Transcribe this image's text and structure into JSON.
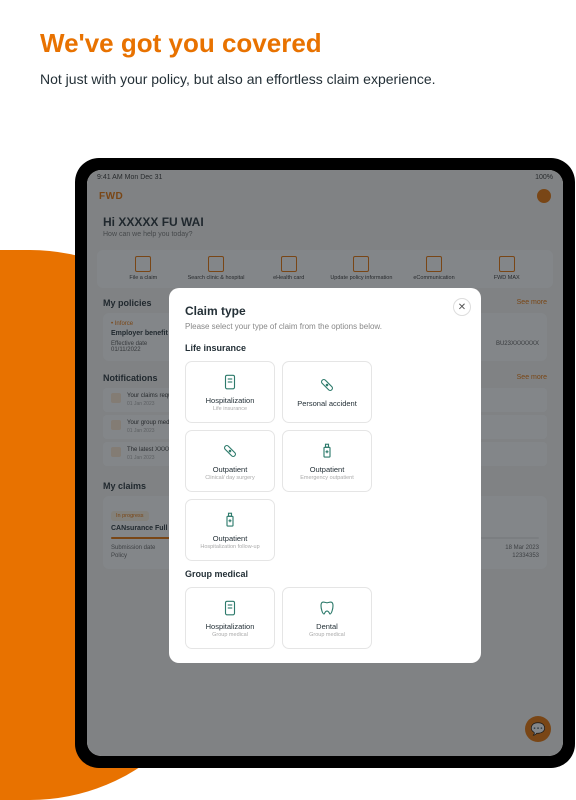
{
  "hero": {
    "title": "We've got you covered",
    "subtitle": "Not just with your policy, but also an effortless claim experience."
  },
  "status": {
    "time": "9:41 AM Mon Dec 31",
    "right": "100%"
  },
  "brand": "FWD",
  "greeting": {
    "hello": "Hi XXXXX FU WAI",
    "sub": "How can we help you today?"
  },
  "quickActions": [
    {
      "label": "File a claim"
    },
    {
      "label": "Search clinic & hospital"
    },
    {
      "label": "eHealth card"
    },
    {
      "label": "Update policy information"
    },
    {
      "label": "eCommunication"
    },
    {
      "label": "FWD MAX"
    }
  ],
  "policies": {
    "heading": "My policies",
    "seeMore": "See more",
    "card": {
      "tag": "• Inforce",
      "name": "Employer benefit\nGroup Medical Insurance",
      "effLabel": "Effective date",
      "effDate": "01/11/2022",
      "policyNo": "BU23XXXXXXX"
    }
  },
  "notifications": {
    "heading": "Notifications",
    "seeMore": "See more",
    "items": [
      {
        "text": "Your claims request has been received",
        "date": "01 Jan 2023"
      },
      {
        "text": "Your group medical policy has been updated",
        "date": "01 Jan 2023"
      },
      {
        "text": "The latest XXXXXX is now available",
        "date": "01 Jan 2023"
      }
    ]
  },
  "claims": {
    "heading": "My claims",
    "tag": "In progress",
    "plan": "CANsurance Full Medical Plan",
    "rows": [
      {
        "k": "Submission date",
        "v": "18 Mar 2023"
      },
      {
        "k": "Policy",
        "v": "12334353"
      }
    ]
  },
  "modal": {
    "title": "Claim type",
    "subtitle": "Please select your type of claim from the options below.",
    "groups": [
      {
        "label": "Life insurance",
        "tiles": [
          {
            "title": "Hospitalization",
            "sub": "Life insurance",
            "icon": "doc"
          },
          {
            "title": "Personal accident",
            "sub": "",
            "icon": "bandage"
          },
          {
            "title": "Outpatient",
            "sub": "Clinical/ day surgery",
            "icon": "bandage"
          },
          {
            "title": "Outpatient",
            "sub": "Emergency outpatient",
            "icon": "bottle"
          },
          {
            "title": "Outpatient",
            "sub": "Hospitalization follow-up",
            "icon": "bottle"
          }
        ]
      },
      {
        "label": "Group medical",
        "tiles": [
          {
            "title": "Hospitalization",
            "sub": "Group medical",
            "icon": "doc"
          },
          {
            "title": "Dental",
            "sub": "Group medical",
            "icon": "tooth"
          }
        ]
      }
    ]
  }
}
